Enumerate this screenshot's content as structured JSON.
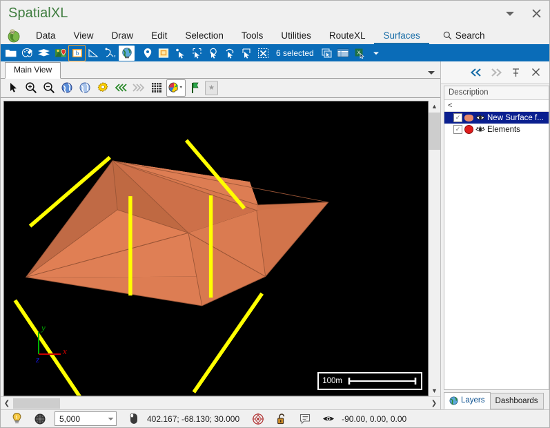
{
  "window": {
    "title": "SpatialXL",
    "controls": [
      {
        "name": "ribbon-display-options",
        "glyph": "▾"
      },
      {
        "name": "close",
        "glyph": "✕"
      }
    ]
  },
  "menu": {
    "app_icon": "globe-app-icon",
    "items": [
      {
        "label": "Data",
        "active": false
      },
      {
        "label": "View",
        "active": false
      },
      {
        "label": "Draw",
        "active": false
      },
      {
        "label": "Edit",
        "active": false
      },
      {
        "label": "Selection",
        "active": false
      },
      {
        "label": "Tools",
        "active": false
      },
      {
        "label": "Utilities",
        "active": false
      },
      {
        "label": "RouteXL",
        "active": false
      },
      {
        "label": "Surfaces",
        "active": true
      }
    ],
    "search_label": "Search",
    "accent_color": "#1a6ea8"
  },
  "toolbar": {
    "background_color": "#0a6cb8",
    "selection_label": "6 selected",
    "icons": [
      {
        "name": "open-folder-icon"
      },
      {
        "name": "palette-icon"
      },
      {
        "name": "layers-stack-icon"
      },
      {
        "name": "map-pin-image-icon"
      },
      {
        "name": "boundary-icon"
      },
      {
        "name": "measure-angle-icon"
      },
      {
        "name": "curve-tool-icon"
      },
      {
        "name": "globe-icon"
      },
      {
        "name": "location-marker-icon"
      },
      {
        "name": "note-window-icon"
      },
      {
        "name": "select-point-icon"
      },
      {
        "name": "select-rectangle-icon"
      },
      {
        "name": "select-circle-icon"
      },
      {
        "name": "select-lasso-icon"
      },
      {
        "name": "select-box-icon"
      },
      {
        "name": "clear-selection-icon"
      }
    ],
    "trailing_icons": [
      {
        "name": "copy-selection-icon"
      },
      {
        "name": "table-view-icon"
      },
      {
        "name": "export-excel-icon"
      },
      {
        "name": "overflow-caret-icon"
      }
    ]
  },
  "document_tabs": [
    {
      "label": "Main View",
      "active": true
    }
  ],
  "view_toolbar": {
    "icons": [
      {
        "name": "pointer-select-icon"
      },
      {
        "name": "zoom-in-icon"
      },
      {
        "name": "zoom-out-icon"
      },
      {
        "name": "globe-view-icon"
      },
      {
        "name": "globe-extent-icon"
      },
      {
        "name": "settings-gear-icon"
      },
      {
        "name": "previous-view-icon"
      },
      {
        "name": "next-view-icon"
      },
      {
        "name": "grid-icon"
      },
      {
        "name": "color-palette-icon"
      },
      {
        "name": "bookmark-flag-icon"
      },
      {
        "name": "star-button-icon"
      }
    ]
  },
  "viewport": {
    "background_color": "#000000",
    "surface_color": "#e07b4f",
    "surface_shade_dark": "#c06a45",
    "highlight_color": "#ffff00",
    "wireframe_color": "#8a4a30",
    "scale_bar_label": "100m",
    "axes": [
      {
        "label": "y",
        "color": "#00b000"
      },
      {
        "label": "x",
        "color": "#cc0000"
      },
      {
        "label": "z",
        "color": "#0000dd"
      }
    ]
  },
  "layers_panel": {
    "header_buttons": [
      {
        "name": "collapse-left",
        "glyph": "◀◀"
      },
      {
        "name": "expand-right",
        "glyph": "▶▶"
      },
      {
        "name": "pin",
        "glyph": "⚕"
      },
      {
        "name": "close",
        "glyph": "✕"
      }
    ],
    "column_header": "Description",
    "filter_glyph": "<",
    "rows": [
      {
        "label": "New Surface f...",
        "checked": true,
        "selected": true,
        "swatch": "surface-blob-swatch",
        "visibility": "eye-icon"
      },
      {
        "label": "Elements",
        "checked": true,
        "selected": false,
        "swatch": "element-dot-swatch",
        "visibility": "eye-icon"
      }
    ],
    "tabs": [
      {
        "label": "Layers",
        "active": true,
        "icon": "globe-icon"
      },
      {
        "label": "Dashboards",
        "active": false,
        "icon": ""
      }
    ]
  },
  "status_bar": {
    "icons_left": [
      {
        "name": "lightbulb-icon"
      },
      {
        "name": "wireframe-sphere-icon"
      }
    ],
    "zoom_value": "5,000",
    "mouse_icon": "mouse-icon",
    "coordinates": "402.167; -68.130; 30.000",
    "icons_middle": [
      {
        "name": "snap-target-icon"
      },
      {
        "name": "unlock-icon"
      },
      {
        "name": "annotation-icon"
      }
    ],
    "eye_icon": "eye-icon",
    "orientation": "-90.00, 0.00, 0.00"
  }
}
